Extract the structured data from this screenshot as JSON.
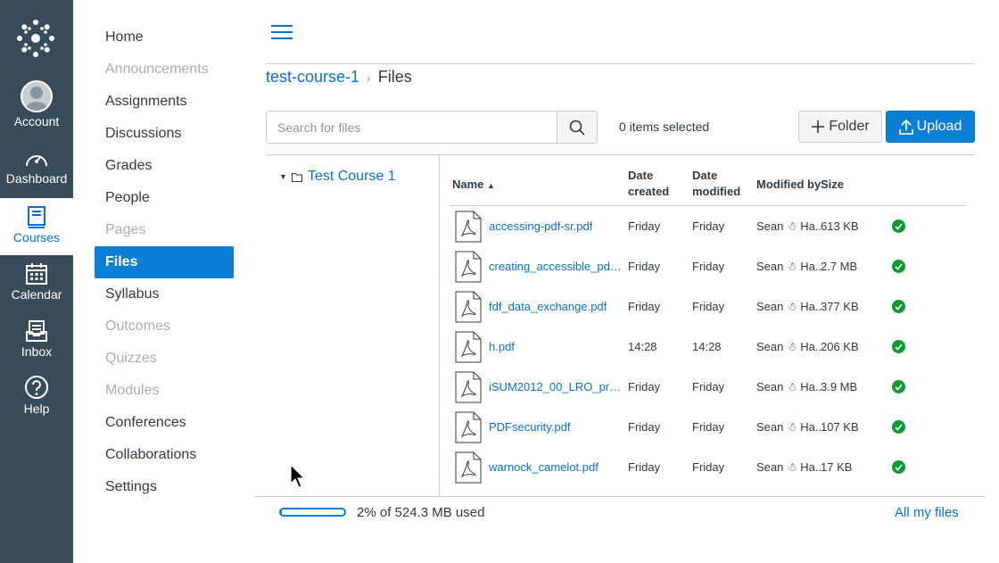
{
  "global_nav": {
    "items": [
      {
        "id": "account",
        "label": "Account",
        "icon": "avatar"
      },
      {
        "id": "dashboard",
        "label": "Dashboard",
        "icon": "speedometer-icon"
      },
      {
        "id": "courses",
        "label": "Courses",
        "icon": "book-icon",
        "active": true
      },
      {
        "id": "calendar",
        "label": "Calendar",
        "icon": "calendar-icon"
      },
      {
        "id": "inbox",
        "label": "Inbox",
        "icon": "inbox-icon"
      },
      {
        "id": "help",
        "label": "Help",
        "icon": "help-icon"
      }
    ]
  },
  "course_nav": {
    "items": [
      {
        "label": "Home",
        "state": "normal"
      },
      {
        "label": "Announcements",
        "state": "disabled"
      },
      {
        "label": "Assignments",
        "state": "normal"
      },
      {
        "label": "Discussions",
        "state": "normal"
      },
      {
        "label": "Grades",
        "state": "normal"
      },
      {
        "label": "People",
        "state": "normal"
      },
      {
        "label": "Pages",
        "state": "disabled"
      },
      {
        "label": "Files",
        "state": "active"
      },
      {
        "label": "Syllabus",
        "state": "normal"
      },
      {
        "label": "Outcomes",
        "state": "disabled"
      },
      {
        "label": "Quizzes",
        "state": "disabled"
      },
      {
        "label": "Modules",
        "state": "disabled"
      },
      {
        "label": "Conferences",
        "state": "normal"
      },
      {
        "label": "Collaborations",
        "state": "normal"
      },
      {
        "label": "Settings",
        "state": "normal"
      }
    ]
  },
  "breadcrumb": {
    "course": "test-course-1",
    "separator": "›",
    "current": "Files"
  },
  "toolbar": {
    "search_placeholder": "Search for files",
    "selected_count": "0 items selected",
    "folder_label": "Folder",
    "upload_label": "Upload"
  },
  "tree": {
    "root_label": "Test Course 1"
  },
  "table": {
    "headers": {
      "name": "Name",
      "date_created_1": "Date",
      "date_created_2": "created",
      "date_modified_1": "Date",
      "date_modified_2": "modified",
      "modified_by": "Modified by",
      "size": "Size"
    },
    "rows": [
      {
        "name": "accessing-pdf-sr.pdf",
        "created": "Friday",
        "modified": "Friday",
        "modified_by": "Sean ☃ Ha...",
        "size": "613 KB"
      },
      {
        "name": "creating_accessible_pdfs...",
        "created": "Friday",
        "modified": "Friday",
        "modified_by": "Sean ☃ Ha...",
        "size": "2.7 MB"
      },
      {
        "name": "fdf_data_exchange.pdf",
        "created": "Friday",
        "modified": "Friday",
        "modified_by": "Sean ☃ Ha...",
        "size": "377 KB"
      },
      {
        "name": "h.pdf",
        "created": "14:28",
        "modified": "14:28",
        "modified_by": "Sean ☃ Ha...",
        "size": "206 KB"
      },
      {
        "name": "iSUM2012_00_LRO_pre...",
        "created": "Friday",
        "modified": "Friday",
        "modified_by": "Sean ☃ Ha...",
        "size": "3.9 MB"
      },
      {
        "name": "PDFsecurity.pdf",
        "created": "Friday",
        "modified": "Friday",
        "modified_by": "Sean ☃ Ha...",
        "size": "107 KB"
      },
      {
        "name": "warnock_camelot.pdf",
        "created": "Friday",
        "modified": "Friday",
        "modified_by": "Sean ☃ Ha...",
        "size": "17 KB"
      }
    ]
  },
  "footer": {
    "quota_fraction": 0.02,
    "quota_text": "2% of 524.3 MB used",
    "all_files_label": "All my files"
  },
  "colors": {
    "nav_bg": "#394b58",
    "accent": "#0b7ed6",
    "link": "#0770d0",
    "published": "#0b9c2f"
  }
}
